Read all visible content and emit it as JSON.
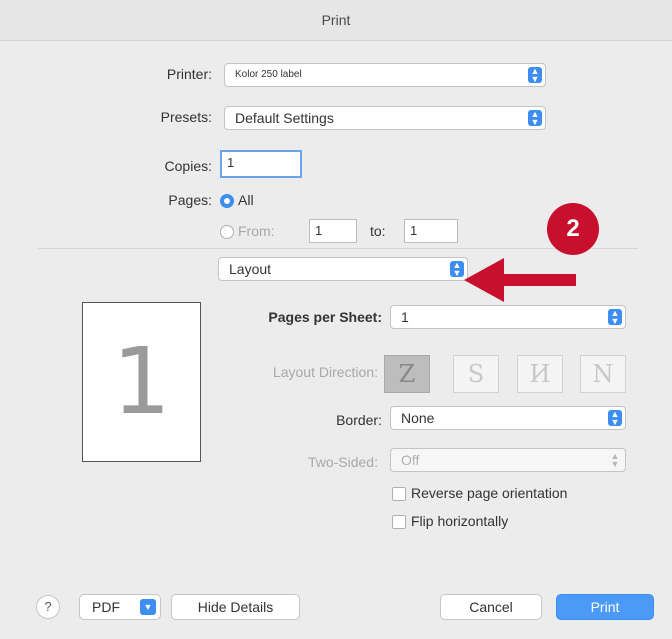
{
  "window": {
    "title": "Print"
  },
  "printer": {
    "label": "Printer:",
    "value": "Kolor 250 label"
  },
  "presets": {
    "label": "Presets:",
    "value": "Default Settings"
  },
  "copies": {
    "label": "Copies:",
    "value": "1"
  },
  "pages": {
    "label": "Pages:",
    "all_label": "All",
    "from_label": "From:",
    "from_value": "1",
    "to_label": "to:",
    "to_value": "1"
  },
  "section_select": {
    "value": "Layout"
  },
  "preview": {
    "page_number": "1"
  },
  "layout": {
    "pages_per_sheet_label": "Pages per Sheet:",
    "pages_per_sheet_value": "1",
    "direction_label": "Layout Direction:",
    "directions": [
      "Z",
      "S",
      "И",
      "N"
    ],
    "border_label": "Border:",
    "border_value": "None",
    "two_sided_label": "Two-Sided:",
    "two_sided_value": "Off",
    "reverse_label": "Reverse page orientation",
    "flip_label": "Flip horizontally"
  },
  "footer": {
    "help": "?",
    "pdf": "PDF",
    "hide_details": "Hide Details",
    "cancel": "Cancel",
    "print": "Print"
  },
  "annotation": {
    "step": "2",
    "color": "#c8102e"
  },
  "colors": {
    "accent": "#3d8ef0",
    "dialog_bg": "#ececec"
  }
}
